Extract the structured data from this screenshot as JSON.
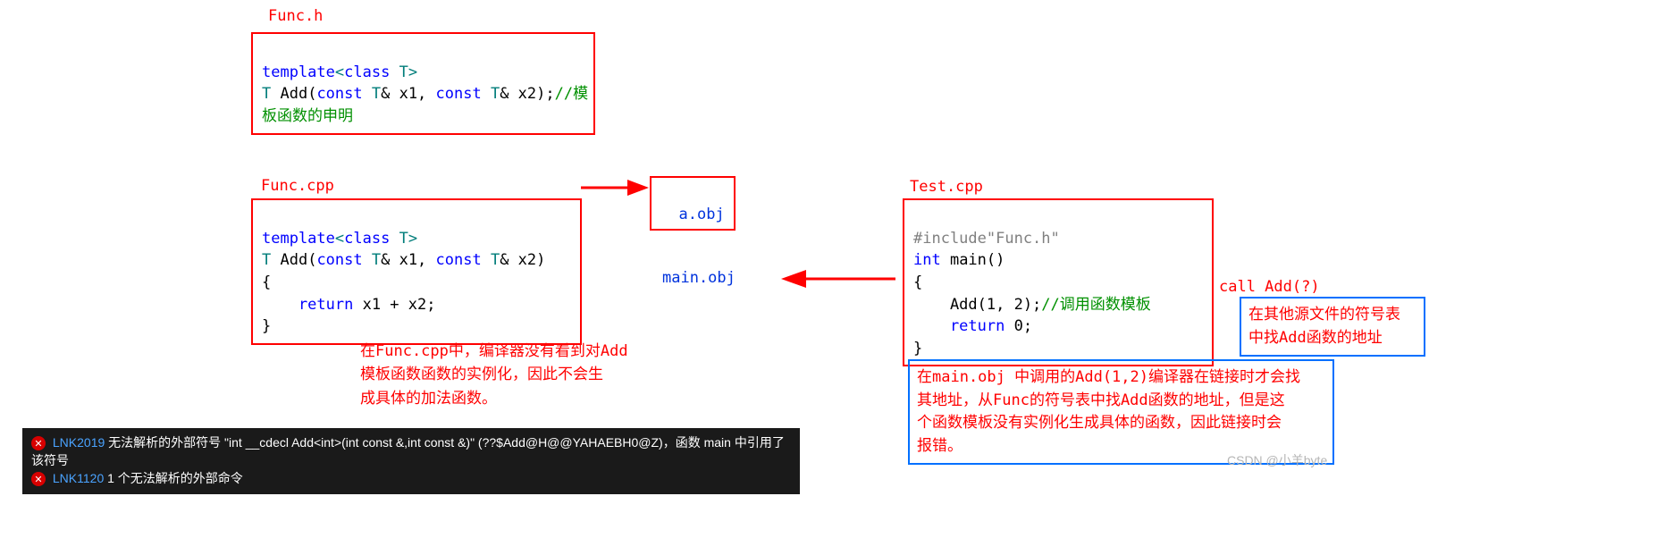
{
  "funch": {
    "title": "Func.h",
    "l1a": "template",
    "l1b": "<",
    "l1c": "class",
    "l1d": " T",
    "l1e": ">",
    "l2a": "T",
    "l2b": " Add(",
    "l2c": "const",
    "l2d": " T",
    "l2e": "& x1, ",
    "l2f": "const",
    "l2g": " T",
    "l2h": "& x2);",
    "l2i": "//模",
    "l3": "板函数的申明"
  },
  "funccpp": {
    "title": "Func.cpp",
    "l1a": "template",
    "l1b": "<",
    "l1c": "class",
    "l1d": " T",
    "l1e": ">",
    "l2a": "T",
    "l2b": " Add(",
    "l2c": "const",
    "l2d": " T",
    "l2e": "& x1, ",
    "l2f": "const",
    "l2g": " T",
    "l2h": "& x2)",
    "l3": "{",
    "l4a": "    return",
    "l4b": " x1 + x2;",
    "l5": "}"
  },
  "testcpp": {
    "title": "Test.cpp",
    "l1": "#include\"Func.h\"",
    "l2a": "int",
    "l2b": " main()",
    "l3": "{",
    "l4a": "    Add(1, 2);",
    "l4b": "//调用函数模板",
    "l5a": "    return",
    "l5b": " 0;",
    "l6": "}"
  },
  "aobj": "a.obj",
  "mainobj": "main.obj",
  "note_funccpp": "在Func.cpp中，编译器没有看到对Add\n模板函数函数的实例化，因此不会生\n成具体的加法函数。",
  "call_label": "call Add(?)",
  "bluebox1": "在其他源文件的符号表\n中找Add函数的地址",
  "bluebox2": "在main.obj 中调用的Add(1,2)编译器在链接时才会找\n其地址，从Func的符号表中找Add函数的地址，但是这\n个函数模板没有实例化生成具体的函数，因此链接时会\n报错。",
  "errors": {
    "e1code": "LNK2019",
    "e1msg": "无法解析的外部符号 \"int __cdecl Add<int>(int const &,int const &)\" (??$Add@H@@YAHAEBH0@Z)，函数 main 中引用了该符号",
    "e2code": "LNK1120",
    "e2msg": "1 个无法解析的外部命令"
  },
  "watermark": "CSDN @小羊byte"
}
